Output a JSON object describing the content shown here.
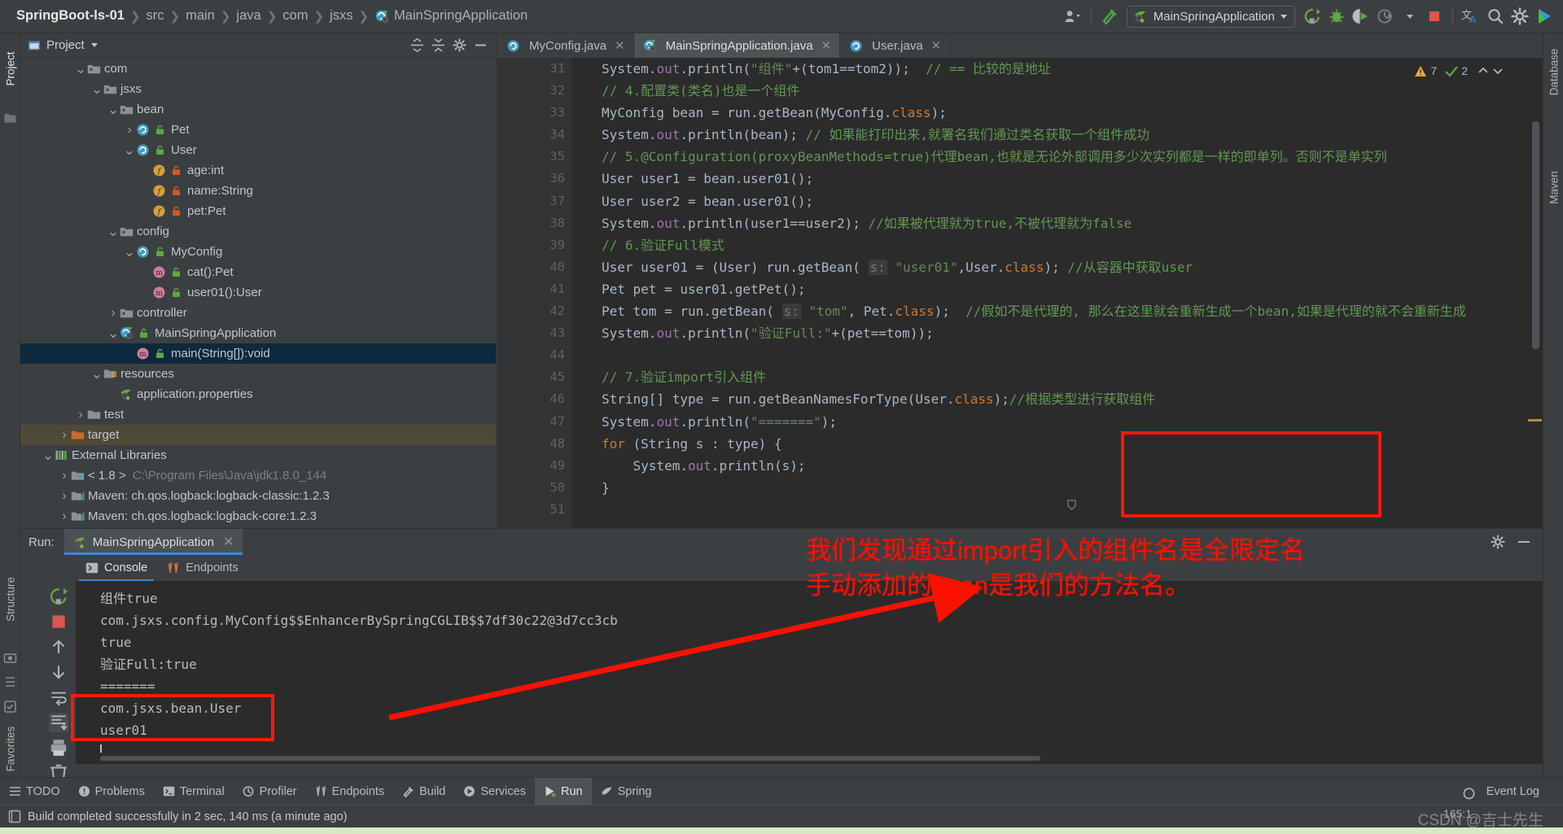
{
  "app": {
    "breadcrumb": [
      "SpringBoot-ls-01",
      "src",
      "main",
      "java",
      "com",
      "jsxs",
      "MainSpringApplication"
    ],
    "run_config": "MainSpringApplication",
    "toolbar_icons": [
      "run-icon",
      "debug-icon",
      "run-with-coverage-icon",
      "profile-icon",
      "dropdown-icon",
      "stop-icon",
      "translate-icon",
      "search-icon",
      "settings-icon",
      "logo-icon"
    ]
  },
  "left_strip": {
    "labels": [
      "Project",
      "Structure",
      "Favorites"
    ]
  },
  "right_strip": {
    "labels": [
      "Database",
      "Maven"
    ]
  },
  "project_panel": {
    "title": "Project",
    "tree": [
      {
        "label": "com",
        "indent": 3,
        "arrow": "down",
        "icon": "package-icon",
        "style": "normal"
      },
      {
        "label": "jsxs",
        "indent": 4,
        "arrow": "down",
        "icon": "package-icon",
        "style": "normal"
      },
      {
        "label": "bean",
        "indent": 5,
        "arrow": "down",
        "icon": "package-icon",
        "style": "normal"
      },
      {
        "label": "Pet",
        "indent": 6,
        "arrow": "right",
        "icon": "class-icon",
        "style": "normal"
      },
      {
        "label": "User",
        "indent": 6,
        "arrow": "down",
        "icon": "class-icon",
        "style": "normal"
      },
      {
        "label": "age:int",
        "indent": 7,
        "arrow": "none",
        "icon": "field-icon",
        "style": "normal"
      },
      {
        "label": "name:String",
        "indent": 7,
        "arrow": "none",
        "icon": "field-icon",
        "style": "normal"
      },
      {
        "label": "pet:Pet",
        "indent": 7,
        "arrow": "none",
        "icon": "field-icon",
        "style": "normal"
      },
      {
        "label": "config",
        "indent": 5,
        "arrow": "down",
        "icon": "package-icon",
        "style": "normal"
      },
      {
        "label": "MyConfig",
        "indent": 6,
        "arrow": "down",
        "icon": "class-icon",
        "style": "normal"
      },
      {
        "label": "cat():Pet",
        "indent": 7,
        "arrow": "none",
        "icon": "method-icon",
        "style": "normal"
      },
      {
        "label": "user01():User",
        "indent": 7,
        "arrow": "none",
        "icon": "method-icon",
        "style": "normal"
      },
      {
        "label": "controller",
        "indent": 5,
        "arrow": "right",
        "icon": "package-icon",
        "style": "normal"
      },
      {
        "label": "MainSpringApplication",
        "indent": 5,
        "arrow": "down",
        "icon": "spring-class-icon",
        "style": "normal"
      },
      {
        "label": "main(String[]):void",
        "indent": 6,
        "arrow": "none",
        "icon": "method-icon",
        "style": "selected"
      },
      {
        "label": "resources",
        "indent": 4,
        "arrow": "down",
        "icon": "resources-icon",
        "style": "normal"
      },
      {
        "label": "application.properties",
        "indent": 5,
        "arrow": "none",
        "icon": "spring-leaf-icon",
        "style": "normal"
      },
      {
        "label": "test",
        "indent": 3,
        "arrow": "right",
        "icon": "folder-icon",
        "style": "normal"
      },
      {
        "label": "target",
        "indent": 2,
        "arrow": "right",
        "icon": "folder-orange-icon",
        "style": "target"
      },
      {
        "label": "External Libraries",
        "indent": 1,
        "arrow": "down",
        "icon": "libraries-icon",
        "style": "normal"
      },
      {
        "label": "< 1.8 >",
        "indent": 2,
        "arrow": "right",
        "icon": "jdk-icon",
        "style": "normal",
        "sub": "C:\\Program Files\\Java\\jdk1.8.0_144"
      },
      {
        "label": "Maven: ch.qos.logback:logback-classic:1.2.3",
        "indent": 2,
        "arrow": "right",
        "icon": "maven-lib-icon",
        "style": "normal"
      },
      {
        "label": "Maven: ch.qos.logback:logback-core:1.2.3",
        "indent": 2,
        "arrow": "right",
        "icon": "maven-lib-icon",
        "style": "normal"
      }
    ]
  },
  "editor": {
    "tabs": [
      {
        "label": "MyConfig.java",
        "icon": "class-icon",
        "active": false
      },
      {
        "label": "MainSpringApplication.java",
        "icon": "spring-class-icon",
        "active": true
      },
      {
        "label": "User.java",
        "icon": "class-icon",
        "active": false
      }
    ],
    "inspection": {
      "warnings": "7",
      "ok": "2"
    },
    "first_line_number": 31,
    "lines": [
      {
        "n": 31,
        "tokens": [
          {
            "t": "System.",
            "c": "n"
          },
          {
            "t": "out",
            "c": "f"
          },
          {
            "t": ".println(",
            "c": "n"
          },
          {
            "t": "\"组件\"",
            "c": "s"
          },
          {
            "t": "+(tom1==tom2));  ",
            "c": "n"
          },
          {
            "t": "// == 比较的是地址",
            "c": "c"
          }
        ]
      },
      {
        "n": 32,
        "tokens": [
          {
            "t": "// 4.配置类(类名)也是一个组件",
            "c": "c"
          }
        ]
      },
      {
        "n": 33,
        "tokens": [
          {
            "t": "MyConfig bean = run.getBean(MyConfig.",
            "c": "n"
          },
          {
            "t": "class",
            "c": "k"
          },
          {
            "t": ");",
            "c": "n"
          }
        ]
      },
      {
        "n": 34,
        "tokens": [
          {
            "t": "System.",
            "c": "n"
          },
          {
            "t": "out",
            "c": "f"
          },
          {
            "t": ".println(bean); ",
            "c": "n"
          },
          {
            "t": "// 如果能打印出来,就署名我们通过类名获取一个组件成功",
            "c": "c"
          }
        ]
      },
      {
        "n": 35,
        "tokens": [
          {
            "t": "// 5.@Configuration(proxyBeanMethods=true)代理bean,也就是无论外部调用多少次实列都是一样的即单列。否则不是单实列",
            "c": "c"
          }
        ]
      },
      {
        "n": 36,
        "tokens": [
          {
            "t": "User user1 = bean.user01();",
            "c": "n"
          }
        ]
      },
      {
        "n": 37,
        "tokens": [
          {
            "t": "User user2 = bean.user01();",
            "c": "n"
          }
        ]
      },
      {
        "n": 38,
        "tokens": [
          {
            "t": "System.",
            "c": "n"
          },
          {
            "t": "out",
            "c": "f"
          },
          {
            "t": ".println(user1==user2); ",
            "c": "n"
          },
          {
            "t": "//如果被代理就为true,不被代理就为false",
            "c": "c"
          }
        ]
      },
      {
        "n": 39,
        "tokens": [
          {
            "t": "// 6.验证Full模式",
            "c": "c"
          }
        ]
      },
      {
        "n": 40,
        "tokens": [
          {
            "t": "User user01 = (User) run.getBean( ",
            "c": "n"
          },
          {
            "t": "s:",
            "c": "hint"
          },
          {
            "t": " ",
            "c": "n"
          },
          {
            "t": "\"user01\"",
            "c": "s"
          },
          {
            "t": ",User.",
            "c": "n"
          },
          {
            "t": "class",
            "c": "k"
          },
          {
            "t": "); ",
            "c": "n"
          },
          {
            "t": "//从容器中获取user",
            "c": "c"
          }
        ]
      },
      {
        "n": 41,
        "tokens": [
          {
            "t": "Pet pet = user01.getPet();",
            "c": "n"
          }
        ]
      },
      {
        "n": 42,
        "tokens": [
          {
            "t": "Pet tom = run.getBean( ",
            "c": "n"
          },
          {
            "t": "s:",
            "c": "hint"
          },
          {
            "t": " ",
            "c": "n"
          },
          {
            "t": "\"tom\"",
            "c": "s"
          },
          {
            "t": ", Pet.",
            "c": "n"
          },
          {
            "t": "class",
            "c": "k"
          },
          {
            "t": ");  ",
            "c": "n"
          },
          {
            "t": "//假如不是代理的, 那么在这里就会重新生成一个bean,如果是代理的就不会重新生成",
            "c": "c"
          }
        ]
      },
      {
        "n": 43,
        "tokens": [
          {
            "t": "System.",
            "c": "n"
          },
          {
            "t": "out",
            "c": "f"
          },
          {
            "t": ".println(",
            "c": "n"
          },
          {
            "t": "\"验证Full:\"",
            "c": "s"
          },
          {
            "t": "+(pet==tom));",
            "c": "n"
          }
        ]
      },
      {
        "n": 44,
        "tokens": []
      },
      {
        "n": 45,
        "tokens": [
          {
            "t": "// 7.验证import引入组件",
            "c": "c"
          }
        ]
      },
      {
        "n": 46,
        "tokens": [
          {
            "t": "String[] type = run.getBeanNamesForType(User.",
            "c": "n"
          },
          {
            "t": "class",
            "c": "k"
          },
          {
            "t": ");",
            "c": "n"
          },
          {
            "t": "//根据类型进行获取组件",
            "c": "c"
          }
        ]
      },
      {
        "n": 47,
        "tokens": [
          {
            "t": "System.",
            "c": "n"
          },
          {
            "t": "out",
            "c": "f"
          },
          {
            "t": ".println(",
            "c": "n"
          },
          {
            "t": "\"=======\"",
            "c": "s"
          },
          {
            "t": ");",
            "c": "n"
          }
        ]
      },
      {
        "n": 48,
        "tokens": [
          {
            "t": "for",
            "c": "k"
          },
          {
            "t": " (String s : type) {",
            "c": "n"
          }
        ]
      },
      {
        "n": 49,
        "tokens": [
          {
            "t": "    System.",
            "c": "n"
          },
          {
            "t": "out",
            "c": "f"
          },
          {
            "t": ".println(s);",
            "c": "n"
          }
        ]
      },
      {
        "n": 50,
        "tokens": [
          {
            "t": "}",
            "c": "n"
          }
        ]
      },
      {
        "n": 51,
        "tokens": []
      }
    ]
  },
  "run_panel": {
    "label": "Run:",
    "tab": "MainSpringApplication",
    "subtabs": [
      {
        "label": "Console",
        "icon": "console-icon",
        "active": true
      },
      {
        "label": "Endpoints",
        "icon": "endpoints-icon",
        "active": false
      }
    ],
    "console_lines": [
      "组件true",
      "com.jsxs.config.MyConfig$$EnhancerBySpringCGLIB$$7df30c22@3d7cc3cb",
      "true",
      "验证Full:true",
      "=======",
      "com.jsxs.bean.User",
      "user01"
    ],
    "sidebar_icons": [
      "rerun-icon",
      "stop-icon",
      "camera-icon",
      "thread-dump-icon",
      "export-icon",
      "up-icon",
      "down-icon",
      "soft-wrap-icon",
      "scroll-to-end-icon",
      "print-icon",
      "clear-all-icon"
    ]
  },
  "annotations": {
    "line1": "我们发现通过import引入的组件名是全限定名",
    "line2": "手动添加的bean是我们的方法名。",
    "color": "#fa1100"
  },
  "status_bar": {
    "items": [
      {
        "label": "TODO",
        "icon": "todo-icon",
        "active": false
      },
      {
        "label": "Problems",
        "icon": "problems-icon",
        "active": false
      },
      {
        "label": "Terminal",
        "icon": "terminal-icon",
        "active": false
      },
      {
        "label": "Profiler",
        "icon": "profiler-icon",
        "active": false
      },
      {
        "label": "Endpoints",
        "icon": "endpoints-icon",
        "active": false
      },
      {
        "label": "Build",
        "icon": "build-icon",
        "active": false
      },
      {
        "label": "Services",
        "icon": "services-icon",
        "active": false
      },
      {
        "label": "Run",
        "icon": "run-icon",
        "active": true
      },
      {
        "label": "Spring",
        "icon": "spring-icon",
        "active": false
      }
    ],
    "event_log": "Event Log",
    "build_message": "Build completed successfully in 2 sec, 140 ms (a minute ago)",
    "caret_position": "165:1",
    "watermark": "CSDN @吉士先生"
  }
}
